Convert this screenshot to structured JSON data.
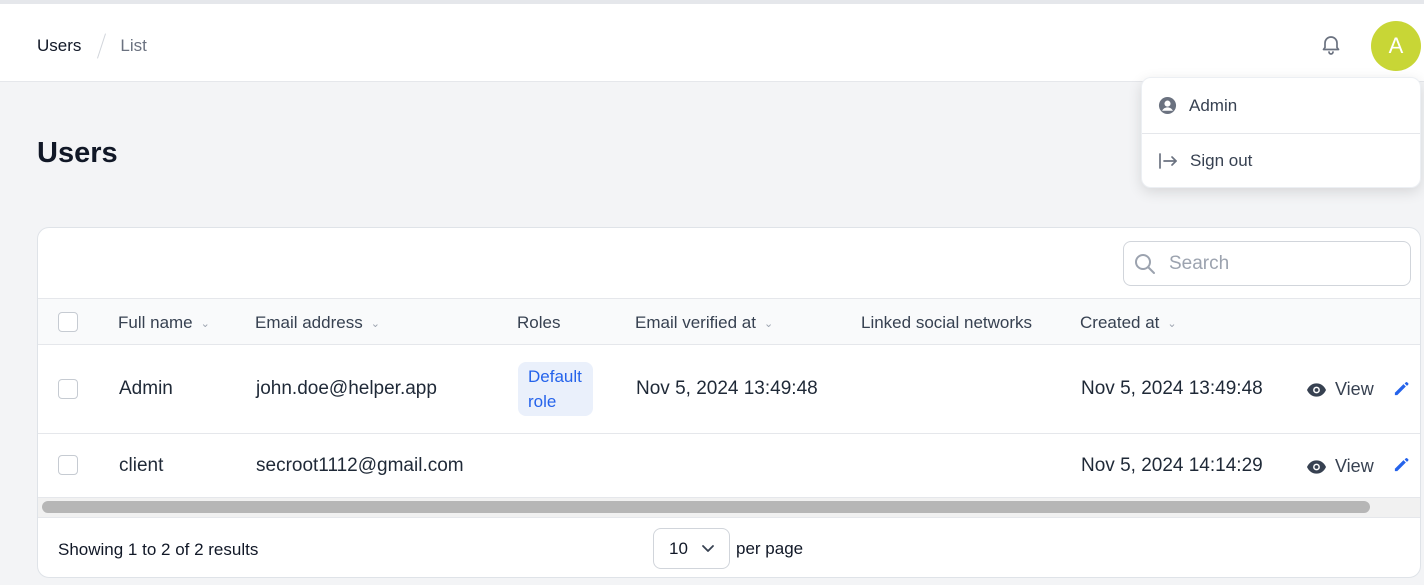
{
  "breadcrumb": {
    "items": [
      "Users",
      "List"
    ]
  },
  "user_menu": {
    "avatar_letter": "A",
    "items": [
      {
        "label": "Admin",
        "icon": "user-circle-icon"
      },
      {
        "label": "Sign out",
        "icon": "sign-out-icon"
      }
    ]
  },
  "page": {
    "title": "Users"
  },
  "table": {
    "search_placeholder": "Search",
    "columns": [
      "Full name",
      "Email address",
      "Roles",
      "Email verified at",
      "Linked social networks",
      "Created at"
    ],
    "rows": [
      {
        "full_name": "Admin",
        "email": "john.doe@helper.app",
        "roles": [
          "Default",
          "role"
        ],
        "email_verified_at": "Nov 5, 2024 13:49:48",
        "linked_social_networks": "",
        "created_at": "Nov 5, 2024 13:49:48",
        "view_label": "View"
      },
      {
        "full_name": "client",
        "email": "secroot1112@gmail.com",
        "roles": [],
        "email_verified_at": "",
        "linked_social_networks": "",
        "created_at": "Nov 5, 2024 14:14:29",
        "view_label": "View"
      }
    ]
  },
  "pagination": {
    "summary": "Showing 1 to 2 of 2 results",
    "per_page_value": "10",
    "per_page_label": "per page"
  },
  "colors": {
    "avatar": "#c8d636",
    "accent": "#2563eb",
    "badge_bg": "#eaf0fb"
  }
}
